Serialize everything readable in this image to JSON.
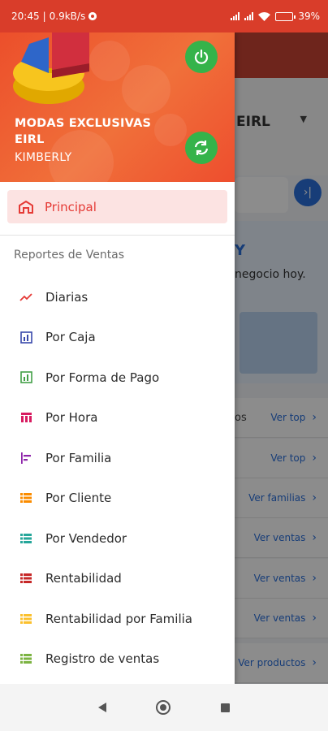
{
  "status_bar": {
    "time": "20:45",
    "speed": "0.9kB/s",
    "battery": "39"
  },
  "background_app": {
    "company": "EIRL",
    "greeting": "Y",
    "subtitle": "negocio hoy.",
    "rows": [
      {
        "lead": "os",
        "link": "Ver top"
      },
      {
        "lead": "",
        "link": "Ver top"
      },
      {
        "lead": "",
        "link": "Ver familias"
      },
      {
        "lead": "",
        "link": "Ver ventas"
      },
      {
        "lead": "",
        "link": "Ver ventas"
      },
      {
        "lead": "",
        "link": "Ver ventas"
      },
      {
        "lead": "",
        "link": "Ver productos"
      }
    ]
  },
  "drawer": {
    "company_name": "MODAS EXCLUSIVAS EIRL",
    "user_name": "KIMBERLY",
    "principal_label": "Principal",
    "section_title": "Reportes de Ventas",
    "menu": [
      {
        "label": "Diarias",
        "icon": "trending-up-icon",
        "color": "#e53935"
      },
      {
        "label": "Por Caja",
        "icon": "bar-chart-box-icon",
        "color": "#3949ab"
      },
      {
        "label": "Por Forma de Pago",
        "icon": "bar-chart-box-icon",
        "color": "#43a047"
      },
      {
        "label": "Por Hora",
        "icon": "calendar-grid-icon",
        "color": "#d81b60"
      },
      {
        "label": "Por Familia",
        "icon": "align-left-bars-icon",
        "color": "#8e24aa"
      },
      {
        "label": "Por Cliente",
        "icon": "list-icon",
        "color": "#fb8c00"
      },
      {
        "label": "Por Vendedor",
        "icon": "list-icon",
        "color": "#26a69a"
      },
      {
        "label": "Rentabilidad",
        "icon": "list-icon",
        "color": "#c62828"
      },
      {
        "label": "Rentabilidad por Familia",
        "icon": "list-icon",
        "color": "#fbc02d"
      },
      {
        "label": "Registro de ventas",
        "icon": "list-icon",
        "color": "#7cb342"
      }
    ]
  },
  "colors": {
    "header_accent": "#ec4f2b",
    "principal_text": "#e53a35",
    "action_green": "#35b34a"
  }
}
